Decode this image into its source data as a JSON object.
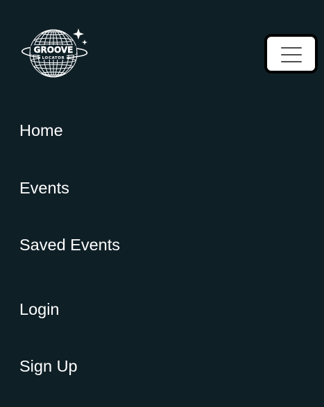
{
  "brand": {
    "logo_word": "GROOVE",
    "logo_subword": "LOCATOR",
    "icon": "disco-globe-logo"
  },
  "toggler": {
    "icon": "hamburger-menu-icon"
  },
  "nav": {
    "items": [
      {
        "label": "Home"
      },
      {
        "label": "Events"
      },
      {
        "label": "Saved Events"
      },
      {
        "label": "Login"
      },
      {
        "label": "Sign Up"
      }
    ]
  },
  "colors": {
    "background": "#0f1f26",
    "text": "#ffffff",
    "toggler_bg": "#ffffff",
    "toggler_border": "#000000",
    "toggler_lines": "#4d4d4d"
  }
}
